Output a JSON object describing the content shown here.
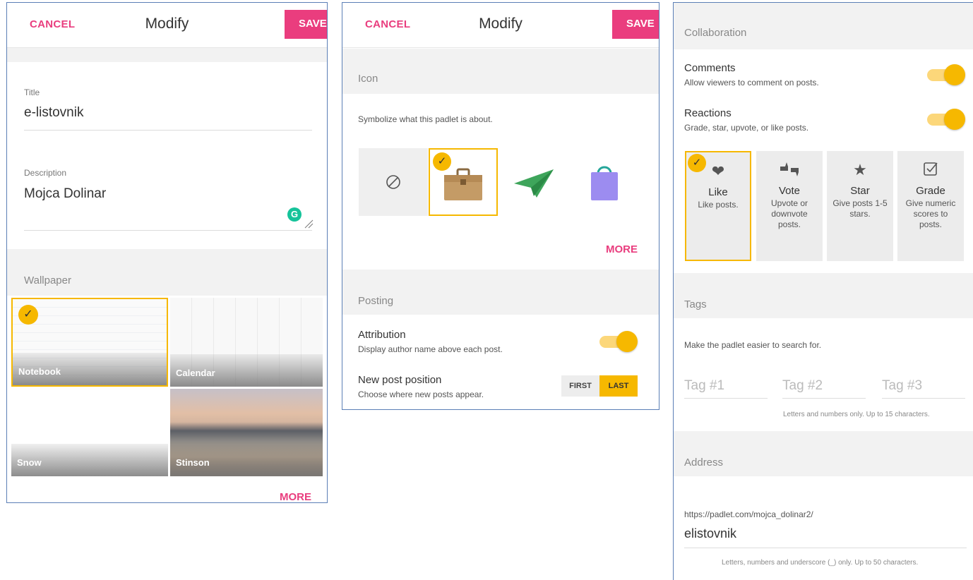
{
  "panel1": {
    "header": {
      "cancel": "CANCEL",
      "title": "Modify",
      "save": "SAVE"
    },
    "title_field": {
      "label": "Title",
      "value": "e-listovnik"
    },
    "description_field": {
      "label": "Description",
      "value": "Mojca Dolinar"
    },
    "wallpaper": {
      "heading": "Wallpaper",
      "items": [
        {
          "label": "Notebook",
          "selected": true
        },
        {
          "label": "Calendar",
          "selected": false
        },
        {
          "label": "Snow",
          "selected": false
        },
        {
          "label": "Stinson",
          "selected": false
        }
      ],
      "more": "MORE"
    }
  },
  "panel2": {
    "header": {
      "cancel": "CANCEL",
      "title": "Modify",
      "save": "SAVE"
    },
    "icon": {
      "heading": "Icon",
      "description": "Symbolize what this padlet is about.",
      "options": [
        "none-icon",
        "briefcase-icon",
        "paper-plane-icon",
        "shopping-bag-icon"
      ],
      "selected": "briefcase-icon",
      "more": "MORE"
    },
    "posting": {
      "heading": "Posting",
      "attribution": {
        "title": "Attribution",
        "subtitle": "Display author name above each post.",
        "enabled": true
      },
      "new_post_position": {
        "title": "New post position",
        "subtitle": "Choose where new posts appear.",
        "options": [
          "FIRST",
          "LAST"
        ],
        "selected": "LAST"
      }
    }
  },
  "panel3": {
    "collaboration": {
      "heading": "Collaboration",
      "comments": {
        "title": "Comments",
        "subtitle": "Allow viewers to comment on posts.",
        "enabled": true
      },
      "reactions": {
        "title": "Reactions",
        "subtitle": "Grade, star, upvote, or like posts.",
        "enabled": true
      },
      "reaction_types": [
        {
          "name": "Like",
          "desc": "Like posts.",
          "icon": "heart-icon",
          "selected": true
        },
        {
          "name": "Vote",
          "desc": "Upvote or downvote posts.",
          "icon": "thumbs-icon",
          "selected": false
        },
        {
          "name": "Star",
          "desc": "Give posts 1-5 stars.",
          "icon": "star-icon",
          "selected": false
        },
        {
          "name": "Grade",
          "desc": "Give numeric scores to posts.",
          "icon": "checkbox-icon",
          "selected": false
        }
      ]
    },
    "tags": {
      "heading": "Tags",
      "description": "Make the padlet easier to search for.",
      "placeholders": [
        "Tag #1",
        "Tag #2",
        "Tag #3"
      ],
      "hint": "Letters and numbers only. Up to 15 characters."
    },
    "address": {
      "heading": "Address",
      "prefix": "https://padlet.com/mojca_dolinar2/",
      "value": "elistovnik",
      "hint": "Letters, numbers and underscore (_) only. Up to 50 characters."
    }
  },
  "colors": {
    "accent": "#e93d7e",
    "selection": "#f6b800"
  }
}
